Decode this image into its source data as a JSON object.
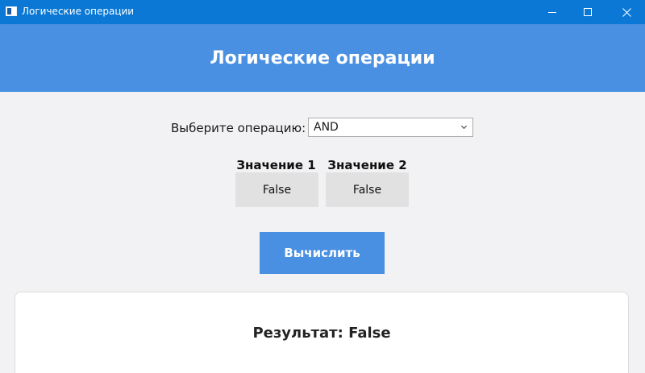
{
  "window": {
    "title": "Логические операции",
    "controls": {
      "minimize": "minimize-icon",
      "maximize": "maximize-icon",
      "close": "close-icon"
    }
  },
  "header": {
    "title": "Логические операции"
  },
  "operation": {
    "label": "Выберите операцию:",
    "selected": "AND"
  },
  "values": [
    {
      "label": "Значение 1",
      "value": "False"
    },
    {
      "label": "Значение 2",
      "value": "False"
    }
  ],
  "actions": {
    "compute_label": "Вычислить"
  },
  "result": {
    "text": "Результат: False"
  },
  "colors": {
    "titlebar": "#0a78d4",
    "accent": "#4a90e2",
    "background": "#f2f2f4"
  }
}
